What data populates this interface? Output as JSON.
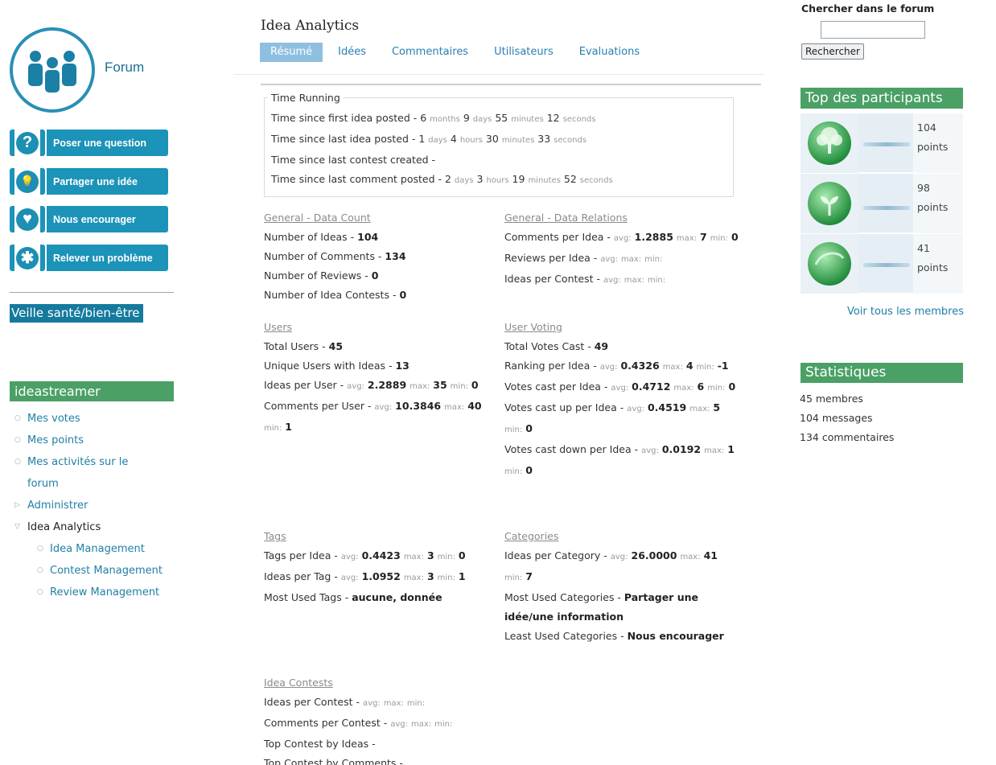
{
  "sidebar": {
    "logo_text": "Forum",
    "actions": [
      {
        "label": "Poser une question",
        "icon": "question-icon",
        "glyph": "?"
      },
      {
        "label": "Partager une idée",
        "icon": "lightbulb-icon",
        "glyph": "💡"
      },
      {
        "label": "Nous encourager",
        "icon": "heart-icon",
        "glyph": "♥"
      },
      {
        "label": "Relever un problème",
        "icon": "bug-icon",
        "glyph": "✱"
      }
    ],
    "veille_title": "Veille santé/bien-être",
    "menu_heading": "ideastreamer",
    "menu": [
      {
        "label": "Mes votes"
      },
      {
        "label": "Mes points"
      },
      {
        "label": "Mes activités sur le forum"
      },
      {
        "label": "Administrer"
      },
      {
        "label": "Idea Analytics"
      },
      {
        "label": "Idea Management"
      },
      {
        "label": "Contest Management"
      },
      {
        "label": "Review Management"
      }
    ]
  },
  "main": {
    "title": "Idea Analytics",
    "tabs": [
      "Résumé",
      "Idées",
      "Commentaires",
      "Utilisateurs",
      "Evaluations"
    ],
    "time_running": {
      "legend": "Time Running",
      "first_idea": {
        "label": "Time since first idea posted - ",
        "v1": "6",
        "u1": "months",
        "v2": "9",
        "u2": "days",
        "v3": "55",
        "u3": "minutes",
        "v4": "12",
        "u4": "seconds"
      },
      "last_idea": {
        "label": "Time since last idea posted - ",
        "v1": "1",
        "u1": "days",
        "v2": "4",
        "u2": "hours",
        "v3": "30",
        "u3": "minutes",
        "v4": "33",
        "u4": "seconds"
      },
      "last_contest": {
        "label": "Time since last contest created - "
      },
      "last_comment": {
        "label": "Time since last comment posted - ",
        "v1": "2",
        "u1": "days",
        "v2": "3",
        "u2": "hours",
        "v3": "19",
        "u3": "minutes",
        "v4": "52",
        "u4": "seconds"
      }
    },
    "labels": {
      "avg": "avg:",
      "max": "max:",
      "min": "min:"
    },
    "general_count": {
      "heading": "General - Data Count",
      "ideas_label": "Number of Ideas - ",
      "ideas": "104",
      "comments_label": "Number of Comments - ",
      "comments": "134",
      "reviews_label": "Number of Reviews - ",
      "reviews": "0",
      "contests_label": "Number of Idea Contests - ",
      "contests": "0"
    },
    "general_relations": {
      "heading": "General - Data Relations",
      "cpi_label": "Comments per Idea - ",
      "cpi_avg": "1.2885",
      "cpi_max": "7",
      "cpi_min": "0",
      "rpi_label": "Reviews per Idea - ",
      "ipc_label": "Ideas per Contest - "
    },
    "users": {
      "heading": "Users",
      "total_label": "Total Users - ",
      "total": "45",
      "unique_label": "Unique Users with Ideas - ",
      "unique": "13",
      "ipu_label": "Ideas per User - ",
      "ipu_avg": "2.2889",
      "ipu_max": "35",
      "ipu_min": "0",
      "cpu_label": "Comments per User - ",
      "cpu_avg": "10.3846",
      "cpu_max": "40",
      "cpu_min": "1"
    },
    "user_voting": {
      "heading": "User Voting",
      "tvc_label": "Total Votes Cast - ",
      "tvc": "49",
      "rpi_label": "Ranking per Idea - ",
      "rpi_avg": "0.4326",
      "rpi_max": "4",
      "rpi_min": "-1",
      "vci_label": "Votes cast per Idea - ",
      "vci_avg": "0.4712",
      "vci_max": "6",
      "vci_min": "0",
      "vcu_label": "Votes cast up per Idea - ",
      "vcu_avg": "0.4519",
      "vcu_max": "5",
      "vcu_min": "0",
      "vcd_label": "Votes cast down per Idea - ",
      "vcd_avg": "0.0192",
      "vcd_max": "1",
      "vcd_min": "0"
    },
    "tags": {
      "heading": "Tags",
      "tpi_label": "Tags per Idea - ",
      "tpi_avg": "0.4423",
      "tpi_max": "3",
      "tpi_min": "0",
      "ipt_label": "Ideas per Tag - ",
      "ipt_avg": "1.0952",
      "ipt_max": "3",
      "ipt_min": "1",
      "most_label": "Most Used Tags - ",
      "most": "aucune, donnée"
    },
    "categories": {
      "heading": "Categories",
      "ipc_label": "Ideas per Category - ",
      "ipc_avg": "26.0000",
      "ipc_max": "41",
      "ipc_min": "7",
      "most_label": "Most Used Categories - ",
      "most": "Partager une idée/une information",
      "least_label": "Least Used Categories - ",
      "least": "Nous encourager"
    },
    "idea_contests": {
      "heading": "Idea Contests",
      "ipc_label": "Ideas per Contest - ",
      "cpc_label": "Comments per Contest - ",
      "tci_label": "Top Contest by Ideas - ",
      "tcc_label": "Top Contest by Comments - "
    }
  },
  "right": {
    "search_label": "Chercher dans le forum",
    "search_value": "",
    "search_button": "Rechercher",
    "top_heading": "Top des participants",
    "participants": [
      {
        "points": "104",
        "unit": "points"
      },
      {
        "points": "98",
        "unit": "points"
      },
      {
        "points": "41",
        "unit": "points"
      }
    ],
    "all_members": "Voir tous les membres",
    "stats_heading": "Statistiques",
    "stats": [
      "45 membres",
      "104 messages",
      "134 commentaires"
    ]
  },
  "colors": {
    "accent": "#1c93b8",
    "green": "#4aa065",
    "link": "#1f7fa6",
    "tab_active": "#8fbfe0"
  }
}
